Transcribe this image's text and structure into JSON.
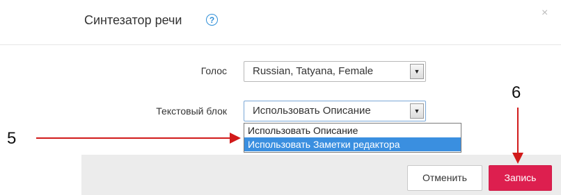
{
  "dialog": {
    "title": "Синтезатор речи",
    "help_symbol": "?",
    "close_symbol": "×"
  },
  "form": {
    "voice_label": "Голос",
    "voice_value": "Russian, Tatyana, Female",
    "text_block_label": "Текстовый блок",
    "text_block_value": "Использовать Описание",
    "dropdown_options": [
      {
        "label": "Использовать Описание",
        "selected": false
      },
      {
        "label": "Использовать Заметки редактора",
        "selected": true
      }
    ]
  },
  "footer": {
    "cancel_label": "Отменить",
    "record_label": "Запись"
  },
  "annotations": {
    "marker_5": "5",
    "marker_6": "6",
    "color": "#d11a1a"
  },
  "colors": {
    "accent": "#dd1f4f",
    "selection": "#3a8fe0",
    "help": "#2f8fd8"
  }
}
